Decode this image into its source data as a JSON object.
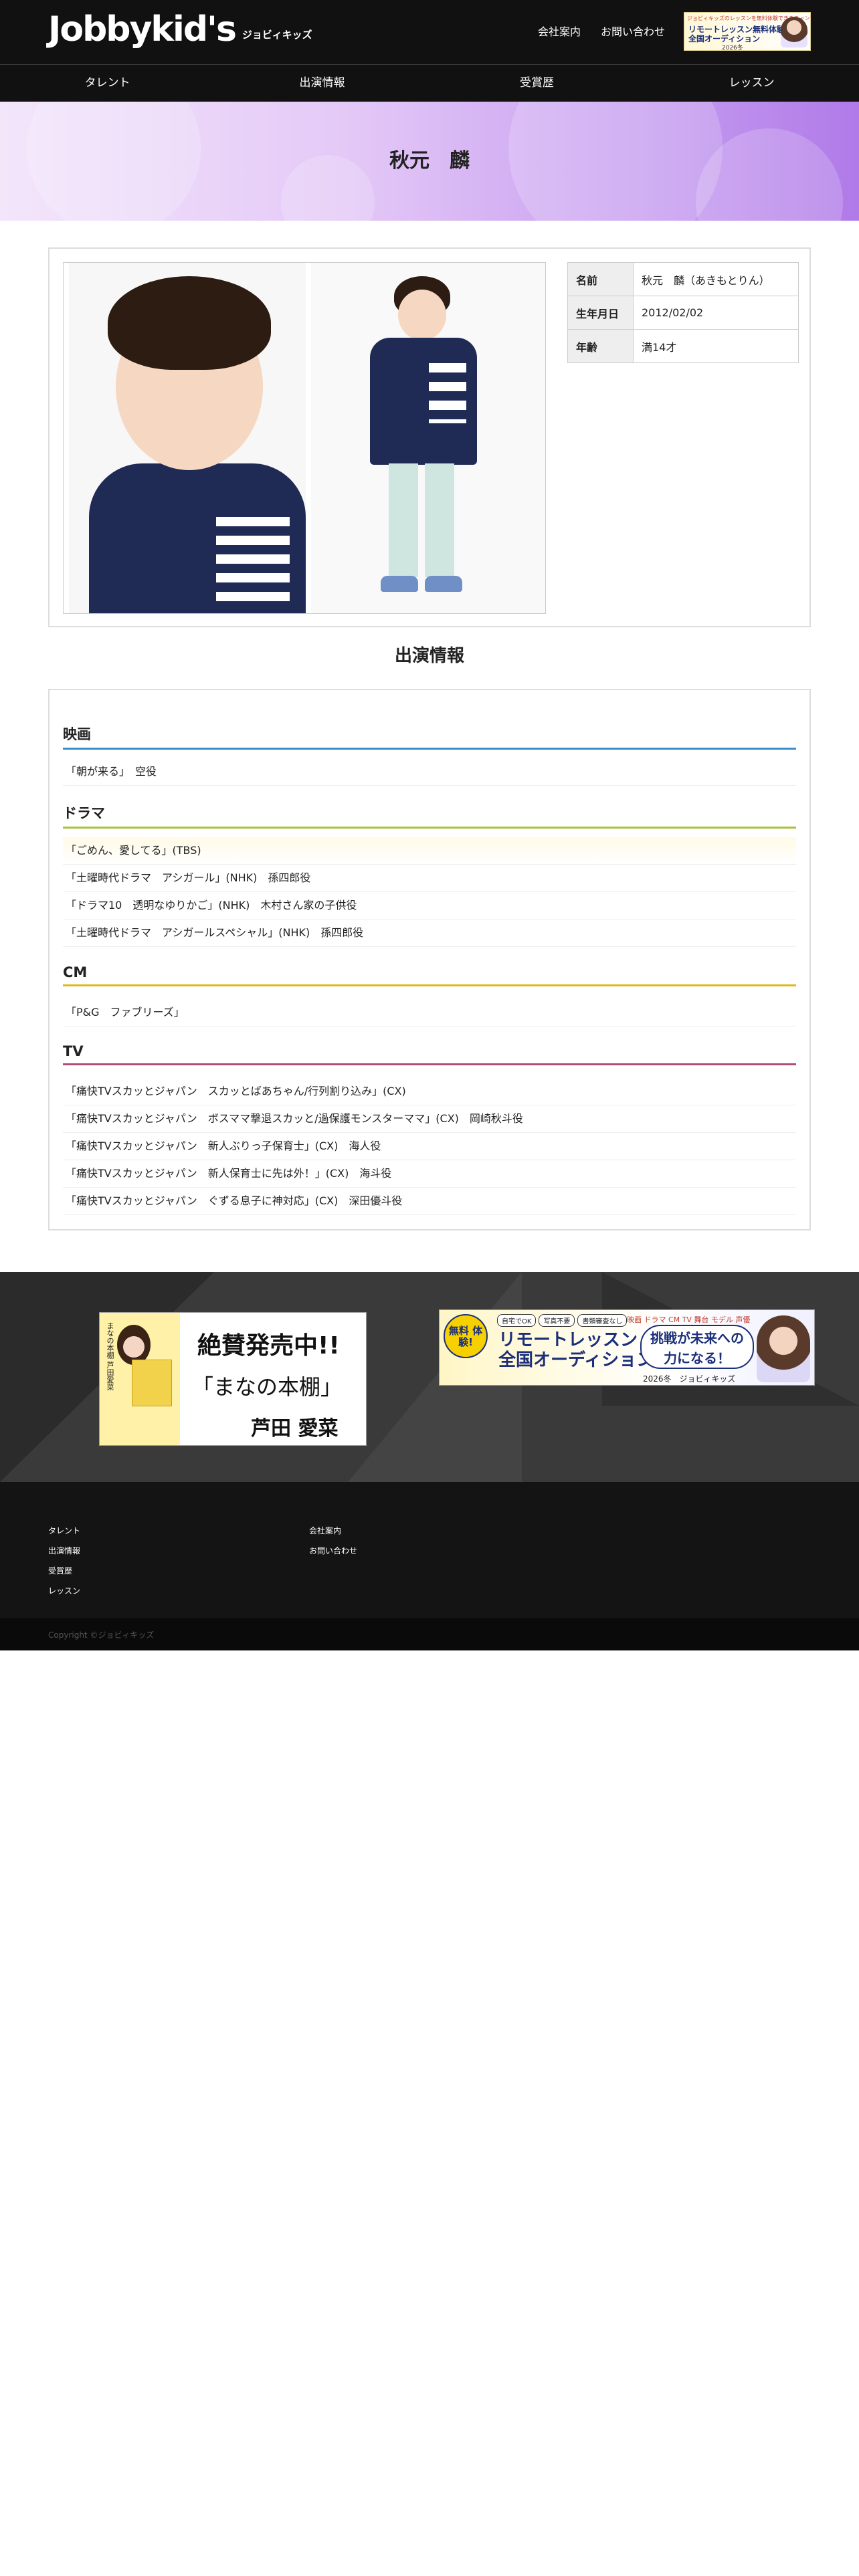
{
  "header": {
    "logo": "Jobbykid's",
    "logo_sub": "ジョビィキッズ",
    "links": [
      "会社案内",
      "お問い合わせ"
    ],
    "banner": {
      "top": "ジョビィキッズのレッスンを無料体験できるチャンス！",
      "mid": "リモートレッスン無料体験",
      "low": "全国オーディション",
      "year": "2026冬"
    }
  },
  "nav": [
    "タレント",
    "出演情報",
    "受賞歴",
    "レッスン"
  ],
  "hero": {
    "title": "秋元　麟"
  },
  "profile": {
    "rows": [
      {
        "key": "名前",
        "value": "秋元　麟（あきもとりん）"
      },
      {
        "key": "生年月日",
        "value": "2012/02/02"
      },
      {
        "key": "年齢",
        "value": "満14才"
      }
    ]
  },
  "appearances": {
    "title": "出演情報",
    "categories": [
      {
        "name": "映画",
        "items": [
          "「朝が来る」　空役"
        ]
      },
      {
        "name": "ドラマ",
        "items": [
          "「ごめん、愛してる」(TBS)",
          "「土曜時代ドラマ　アシガール」(NHK)　孫四郎役",
          "「ドラマ10　透明なゆりかご」(NHK)　木村さん家の子供役",
          "「土曜時代ドラマ　アシガールスペシャル」(NHK)　孫四郎役"
        ]
      },
      {
        "name": "CM",
        "items": [
          "「P&G　ファブリーズ」"
        ]
      },
      {
        "name": "TV",
        "items": [
          "「痛快TVスカッとジャパン　スカッとばあちゃん/行列割り込み」(CX)",
          "「痛快TVスカッとジャパン　ボスママ撃退スカッと/過保護モンスターママ」(CX)　岡崎秋斗役",
          "「痛快TVスカッとジャパン　新人ぶりっ子保育士」(CX)　海人役",
          "「痛快TVスカッとジャパン　新人保育士に先は外！」(CX)　海斗役",
          "「痛快TVスカッとジャパン　ぐずる息子に神対応」(CX)　深田優斗役"
        ]
      }
    ]
  },
  "banners": {
    "book": {
      "side": "まなの本棚 芦田愛菜",
      "line1": "絶賛発売中!!",
      "line2": "「まなの本棚」",
      "line3": "芦田 愛菜"
    },
    "audition": {
      "badge": "無料 体験!",
      "tags": [
        "自宅でOK",
        "写真不要",
        "書類審査なし"
      ],
      "genres": "映画 ドラマ CM TV 舞台 モデル 声優",
      "main1": "リモートレッスン",
      "main2": "全国オーディション",
      "challenge1": "挑戦が未来への",
      "challenge2": "力になる！",
      "year": "2026冬　ジョビィキッズ"
    }
  },
  "footer": {
    "col1": [
      "タレント",
      "出演情報",
      "受賞歴",
      "レッスン"
    ],
    "col2": [
      "会社案内",
      "お問い合わせ"
    ],
    "copyright": "Copyright ©ジョビィキッズ"
  }
}
